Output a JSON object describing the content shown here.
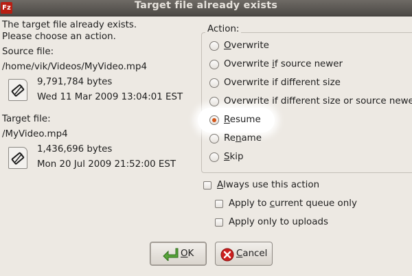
{
  "window": {
    "title": "Target file already exists",
    "app_icon": "Fz"
  },
  "message": {
    "line1": "The target file already exists.",
    "line2": "Please choose an action."
  },
  "source": {
    "label": "Source file:",
    "path": "/home/vik/Videos/MyVideo.mp4",
    "size": "9,791,784 bytes",
    "date": "Wed 11 Mar 2009 13:04:01 EST",
    "icon": "video-file-icon"
  },
  "target": {
    "label": "Target file:",
    "path": "/MyVideo.mp4",
    "size": "1,436,696 bytes",
    "date": "Mon 20 Jul 2009 21:52:00 EST",
    "icon": "video-file-icon"
  },
  "action": {
    "label": "Action:",
    "selected": "resume",
    "options": {
      "overwrite": {
        "pre": "",
        "key": "O",
        "post": "verwrite"
      },
      "if_newer": {
        "pre": "Overwrite ",
        "key": "i",
        "post": "f source newer"
      },
      "if_diff_size": {
        "pre": "Overwrite if different size",
        "key": "",
        "post": ""
      },
      "if_diff_size_or_newer": {
        "pre": "Overwrite if different size or source newer",
        "key": "",
        "post": ""
      },
      "resume": {
        "pre": "",
        "key": "R",
        "post": "esume"
      },
      "rename": {
        "pre": "Re",
        "key": "n",
        "post": "ame"
      },
      "skip": {
        "pre": "",
        "key": "S",
        "post": "kip"
      }
    }
  },
  "options": {
    "always": {
      "pre": "",
      "key": "A",
      "post": "lways use this action",
      "checked": false
    },
    "queue_only": {
      "pre": "Apply to ",
      "key": "c",
      "post": "urrent queue only",
      "checked": false
    },
    "uploads_only": {
      "pre": "Apply only to ",
      "key": "",
      "post": "uploads",
      "checked": false
    }
  },
  "buttons": {
    "ok": {
      "key": "O",
      "post": "K",
      "icon": "green-arrow-icon"
    },
    "cancel": {
      "key": "C",
      "post": "ancel",
      "icon": "cancel-icon"
    }
  },
  "colors": {
    "accent": "#d4571a",
    "title_bar": "#5a5753",
    "dialog_bg": "#ede9e3"
  }
}
